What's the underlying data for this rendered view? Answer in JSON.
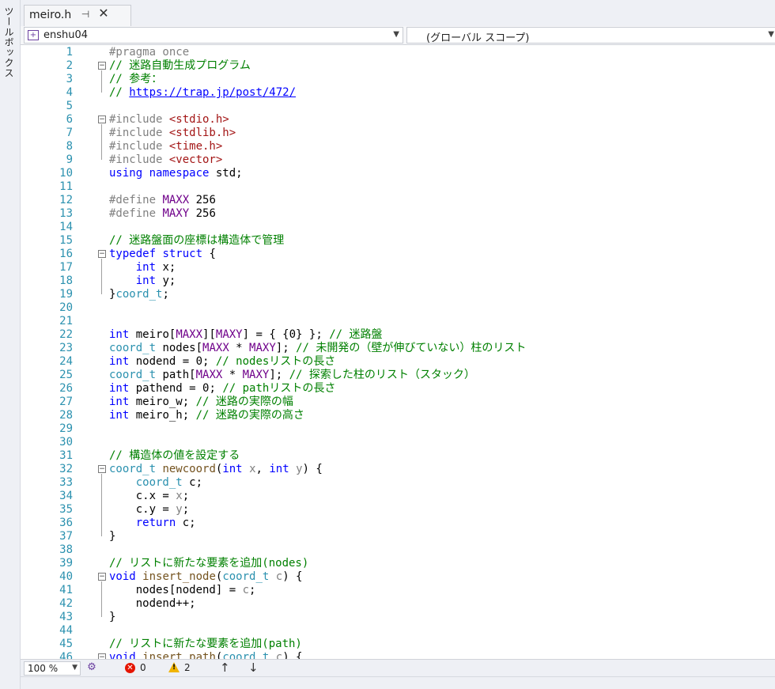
{
  "toolbox": {
    "label": "ツールボックス"
  },
  "tab": {
    "filename": "meiro.h",
    "pin_glyph": "⊣",
    "close_glyph": "✕"
  },
  "navigation": {
    "project": "enshu04",
    "scope": "(グローバル スコープ)"
  },
  "status": {
    "zoom": "100 %",
    "errors": "0",
    "warnings": "2"
  },
  "icons": [
    "toolbox-icon",
    "pin-icon",
    "close-icon",
    "project-icon",
    "chevron-down-icon",
    "health-icon",
    "error-icon",
    "warning-icon",
    "arrow-up-icon",
    "arrow-down-icon"
  ],
  "colors": {
    "line_number": "#2b91af",
    "keyword": "#0000ff",
    "type": "#2b91af",
    "comment": "#008000",
    "string": "#a31515",
    "macro": "#6f008a",
    "preprocessor": "#808080"
  },
  "code_lines": [
    {
      "n": "1",
      "t": [
        [
          "preproc",
          "#pragma once"
        ]
      ]
    },
    {
      "n": "2",
      "fold": true,
      "t": [
        [
          "comment",
          "// 迷路自動生成プログラム"
        ]
      ]
    },
    {
      "n": "3",
      "t": [
        [
          "comment",
          "// 参考："
        ]
      ]
    },
    {
      "n": "4",
      "t": [
        [
          "comment",
          "// "
        ],
        [
          "link",
          "https://trap.jp/post/472/"
        ]
      ]
    },
    {
      "n": "5",
      "t": []
    },
    {
      "n": "6",
      "fold": true,
      "t": [
        [
          "preproc",
          "#include "
        ],
        [
          "str",
          "<stdio.h>"
        ]
      ]
    },
    {
      "n": "7",
      "t": [
        [
          "preproc",
          "#include "
        ],
        [
          "str",
          "<stdlib.h>"
        ]
      ]
    },
    {
      "n": "8",
      "t": [
        [
          "preproc",
          "#include "
        ],
        [
          "str",
          "<time.h>"
        ]
      ]
    },
    {
      "n": "9",
      "t": [
        [
          "preproc",
          "#include "
        ],
        [
          "str",
          "<vector>"
        ]
      ]
    },
    {
      "n": "10",
      "t": [
        [
          "kw",
          "using"
        ],
        [
          "plain",
          " "
        ],
        [
          "kw",
          "namespace"
        ],
        [
          "plain",
          " std;"
        ]
      ]
    },
    {
      "n": "11",
      "t": []
    },
    {
      "n": "12",
      "t": [
        [
          "preproc",
          "#define "
        ],
        [
          "macro",
          "MAXX"
        ],
        [
          "plain",
          " 256"
        ]
      ]
    },
    {
      "n": "13",
      "t": [
        [
          "preproc",
          "#define "
        ],
        [
          "macro",
          "MAXY"
        ],
        [
          "plain",
          " 256"
        ]
      ]
    },
    {
      "n": "14",
      "t": []
    },
    {
      "n": "15",
      "t": [
        [
          "comment",
          "// 迷路盤面の座標は構造体で管理"
        ]
      ]
    },
    {
      "n": "16",
      "fold": true,
      "t": [
        [
          "kw",
          "typedef"
        ],
        [
          "plain",
          " "
        ],
        [
          "kw",
          "struct"
        ],
        [
          "plain",
          " {"
        ]
      ]
    },
    {
      "n": "17",
      "t": [
        [
          "plain",
          "    "
        ],
        [
          "kw",
          "int"
        ],
        [
          "plain",
          " x;"
        ]
      ]
    },
    {
      "n": "18",
      "t": [
        [
          "plain",
          "    "
        ],
        [
          "kw",
          "int"
        ],
        [
          "plain",
          " y;"
        ]
      ]
    },
    {
      "n": "19",
      "t": [
        [
          "plain",
          "}"
        ],
        [
          "type",
          "coord_t"
        ],
        [
          "plain",
          ";"
        ]
      ]
    },
    {
      "n": "20",
      "t": []
    },
    {
      "n": "21",
      "t": []
    },
    {
      "n": "22",
      "t": [
        [
          "kw",
          "int"
        ],
        [
          "plain",
          " meiro["
        ],
        [
          "macro",
          "MAXX"
        ],
        [
          "plain",
          "]["
        ],
        [
          "macro",
          "MAXY"
        ],
        [
          "plain",
          "] = { {0} }; "
        ],
        [
          "comment",
          "// 迷路盤"
        ]
      ]
    },
    {
      "n": "23",
      "t": [
        [
          "type",
          "coord_t"
        ],
        [
          "plain",
          " nodes["
        ],
        [
          "macro",
          "MAXX"
        ],
        [
          "plain",
          " * "
        ],
        [
          "macro",
          "MAXY"
        ],
        [
          "plain",
          "]; "
        ],
        [
          "comment",
          "// 未開発の（壁が伸びていない）柱のリスト"
        ]
      ]
    },
    {
      "n": "24",
      "t": [
        [
          "kw",
          "int"
        ],
        [
          "plain",
          " nodend = 0; "
        ],
        [
          "comment",
          "// nodesリストの長さ"
        ]
      ]
    },
    {
      "n": "25",
      "t": [
        [
          "type",
          "coord_t"
        ],
        [
          "plain",
          " path["
        ],
        [
          "macro",
          "MAXX"
        ],
        [
          "plain",
          " * "
        ],
        [
          "macro",
          "MAXY"
        ],
        [
          "plain",
          "]; "
        ],
        [
          "comment",
          "// 探索した柱のリスト（スタック）"
        ]
      ]
    },
    {
      "n": "26",
      "t": [
        [
          "kw",
          "int"
        ],
        [
          "plain",
          " pathend = 0; "
        ],
        [
          "comment",
          "// pathリストの長さ"
        ]
      ]
    },
    {
      "n": "27",
      "t": [
        [
          "kw",
          "int"
        ],
        [
          "plain",
          " meiro_w; "
        ],
        [
          "comment",
          "// 迷路の実際の幅"
        ]
      ]
    },
    {
      "n": "28",
      "t": [
        [
          "kw",
          "int"
        ],
        [
          "plain",
          " meiro_h; "
        ],
        [
          "comment",
          "// 迷路の実際の高さ"
        ]
      ]
    },
    {
      "n": "29",
      "t": []
    },
    {
      "n": "30",
      "t": []
    },
    {
      "n": "31",
      "t": [
        [
          "comment",
          "// 構造体の値を設定する"
        ]
      ]
    },
    {
      "n": "32",
      "fold": true,
      "t": [
        [
          "type",
          "coord_t"
        ],
        [
          "plain",
          " "
        ],
        [
          "func",
          "newcoord"
        ],
        [
          "plain",
          "("
        ],
        [
          "kw",
          "int"
        ],
        [
          "plain",
          " "
        ],
        [
          "param",
          "x"
        ],
        [
          "plain",
          ", "
        ],
        [
          "kw",
          "int"
        ],
        [
          "plain",
          " "
        ],
        [
          "param",
          "y"
        ],
        [
          "plain",
          ") {"
        ]
      ]
    },
    {
      "n": "33",
      "t": [
        [
          "plain",
          "    "
        ],
        [
          "type",
          "coord_t"
        ],
        [
          "plain",
          " c;"
        ]
      ]
    },
    {
      "n": "34",
      "t": [
        [
          "plain",
          "    c.x = "
        ],
        [
          "param",
          "x"
        ],
        [
          "plain",
          ";"
        ]
      ]
    },
    {
      "n": "35",
      "t": [
        [
          "plain",
          "    c.y = "
        ],
        [
          "param",
          "y"
        ],
        [
          "plain",
          ";"
        ]
      ]
    },
    {
      "n": "36",
      "t": [
        [
          "plain",
          "    "
        ],
        [
          "kw",
          "return"
        ],
        [
          "plain",
          " c;"
        ]
      ]
    },
    {
      "n": "37",
      "t": [
        [
          "plain",
          "}"
        ]
      ]
    },
    {
      "n": "38",
      "t": []
    },
    {
      "n": "39",
      "t": [
        [
          "comment",
          "// リストに新たな要素を追加(nodes)"
        ]
      ]
    },
    {
      "n": "40",
      "fold": true,
      "t": [
        [
          "kw",
          "void"
        ],
        [
          "plain",
          " "
        ],
        [
          "func",
          "insert_node"
        ],
        [
          "plain",
          "("
        ],
        [
          "type",
          "coord_t"
        ],
        [
          "plain",
          " "
        ],
        [
          "param",
          "c"
        ],
        [
          "plain",
          ") {"
        ]
      ]
    },
    {
      "n": "41",
      "t": [
        [
          "plain",
          "    nodes[nodend] = "
        ],
        [
          "param",
          "c"
        ],
        [
          "plain",
          ";"
        ]
      ]
    },
    {
      "n": "42",
      "t": [
        [
          "plain",
          "    nodend++;"
        ]
      ]
    },
    {
      "n": "43",
      "t": [
        [
          "plain",
          "}"
        ]
      ]
    },
    {
      "n": "44",
      "t": []
    },
    {
      "n": "45",
      "t": [
        [
          "comment",
          "// リストに新たな要素を追加(path)"
        ]
      ]
    },
    {
      "n": "46",
      "fold": true,
      "t": [
        [
          "kw",
          "void"
        ],
        [
          "plain",
          " "
        ],
        [
          "func",
          "insert_path"
        ],
        [
          "plain",
          "("
        ],
        [
          "type",
          "coord_t"
        ],
        [
          "plain",
          " "
        ],
        [
          "param",
          "c"
        ],
        [
          "plain",
          ") {"
        ]
      ]
    }
  ]
}
